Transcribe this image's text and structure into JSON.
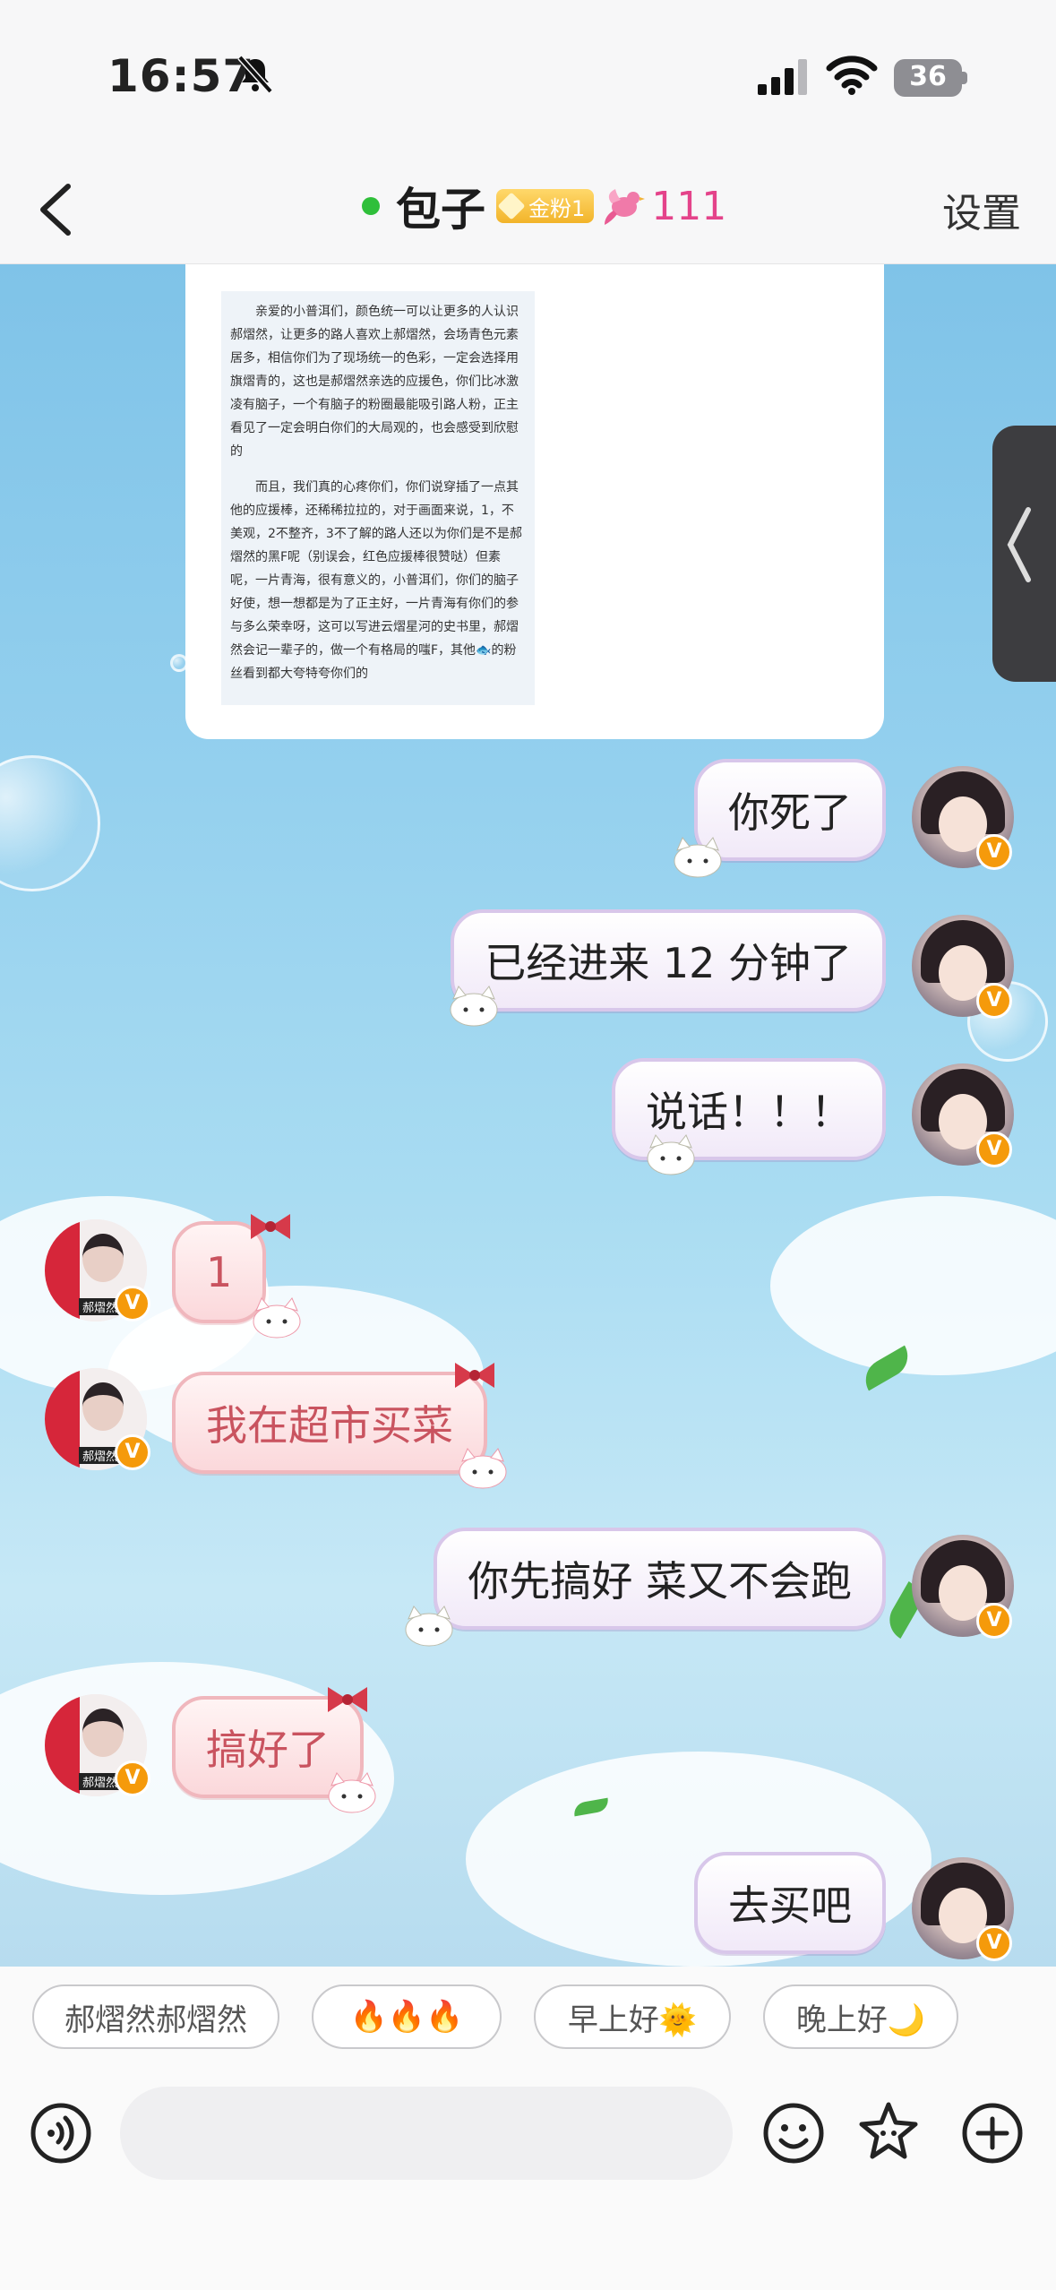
{
  "status_bar": {
    "time": "16:57",
    "battery": "36"
  },
  "nav": {
    "title": "包子",
    "fan_badge": "金粉1",
    "level": "111",
    "settings": "设置"
  },
  "image_card": {
    "paragraph_1": "亲爱的小普洱们，颜色统一可以让更多的人认识郝熠然，让更多的路人喜欢上郝熠然，会场青色元素居多，相信你们为了现场统一的色彩，一定会选择用旗熠青的，这也是郝熠然亲选的应援色，你们比冰激凌有脑子，一个有脑子的粉圈最能吸引路人粉，正主看见了一定会明白你们的大局观的，也会感受到欣慰的",
    "paragraph_2": "而且，我们真的心疼你们，你们说穿插了一点其他的应援棒，还稀稀拉拉的，对于画面来说，1，不美观，2不整齐，3不了解的路人还以为你们是不是郝熠然的黑F呢（别误会，红色应援棒很赞哒）但素呢，一片青海，很有意义的，小普洱们，你们的脑子好使，想一想都是为了正主好，一片青海有你们的参与多么荣幸呀，这可以写进云熠星河的史书里，郝熠然会记一辈子的，做一个有格局的嗤F，其他🐟的粉丝看到都大夸特夸你们的"
  },
  "messages": [
    {
      "side": "self",
      "text": "你死了"
    },
    {
      "side": "self",
      "text": "已经进来 12 分钟了"
    },
    {
      "side": "self",
      "text": "说话！！！"
    },
    {
      "side": "other",
      "text": "1",
      "avatar_tag": "郝熠然"
    },
    {
      "side": "other",
      "text": "我在超市买菜",
      "avatar_tag": "郝熠然"
    },
    {
      "side": "self",
      "text": "你先搞好 菜又不会跑"
    },
    {
      "side": "other",
      "text": "搞好了",
      "avatar_tag": "郝熠然"
    },
    {
      "side": "self",
      "text": "去买吧"
    }
  ],
  "quick_replies": [
    "郝熠然郝熠然",
    "🔥🔥🔥",
    "早上好🌞",
    "晚上好🌙"
  ],
  "input": {
    "placeholder": ""
  },
  "icons": {
    "back": "chevron-left-icon",
    "voice": "voice-icon",
    "emoji": "smile-icon",
    "sticker": "star-icon",
    "more": "plus-icon"
  },
  "colors": {
    "online": "#2fbf3a",
    "level": "#e4438a",
    "self_bubble_border": "#d8c7ea",
    "other_bubble_text": "#c9535f",
    "vip_badge": "#f59a0b"
  }
}
